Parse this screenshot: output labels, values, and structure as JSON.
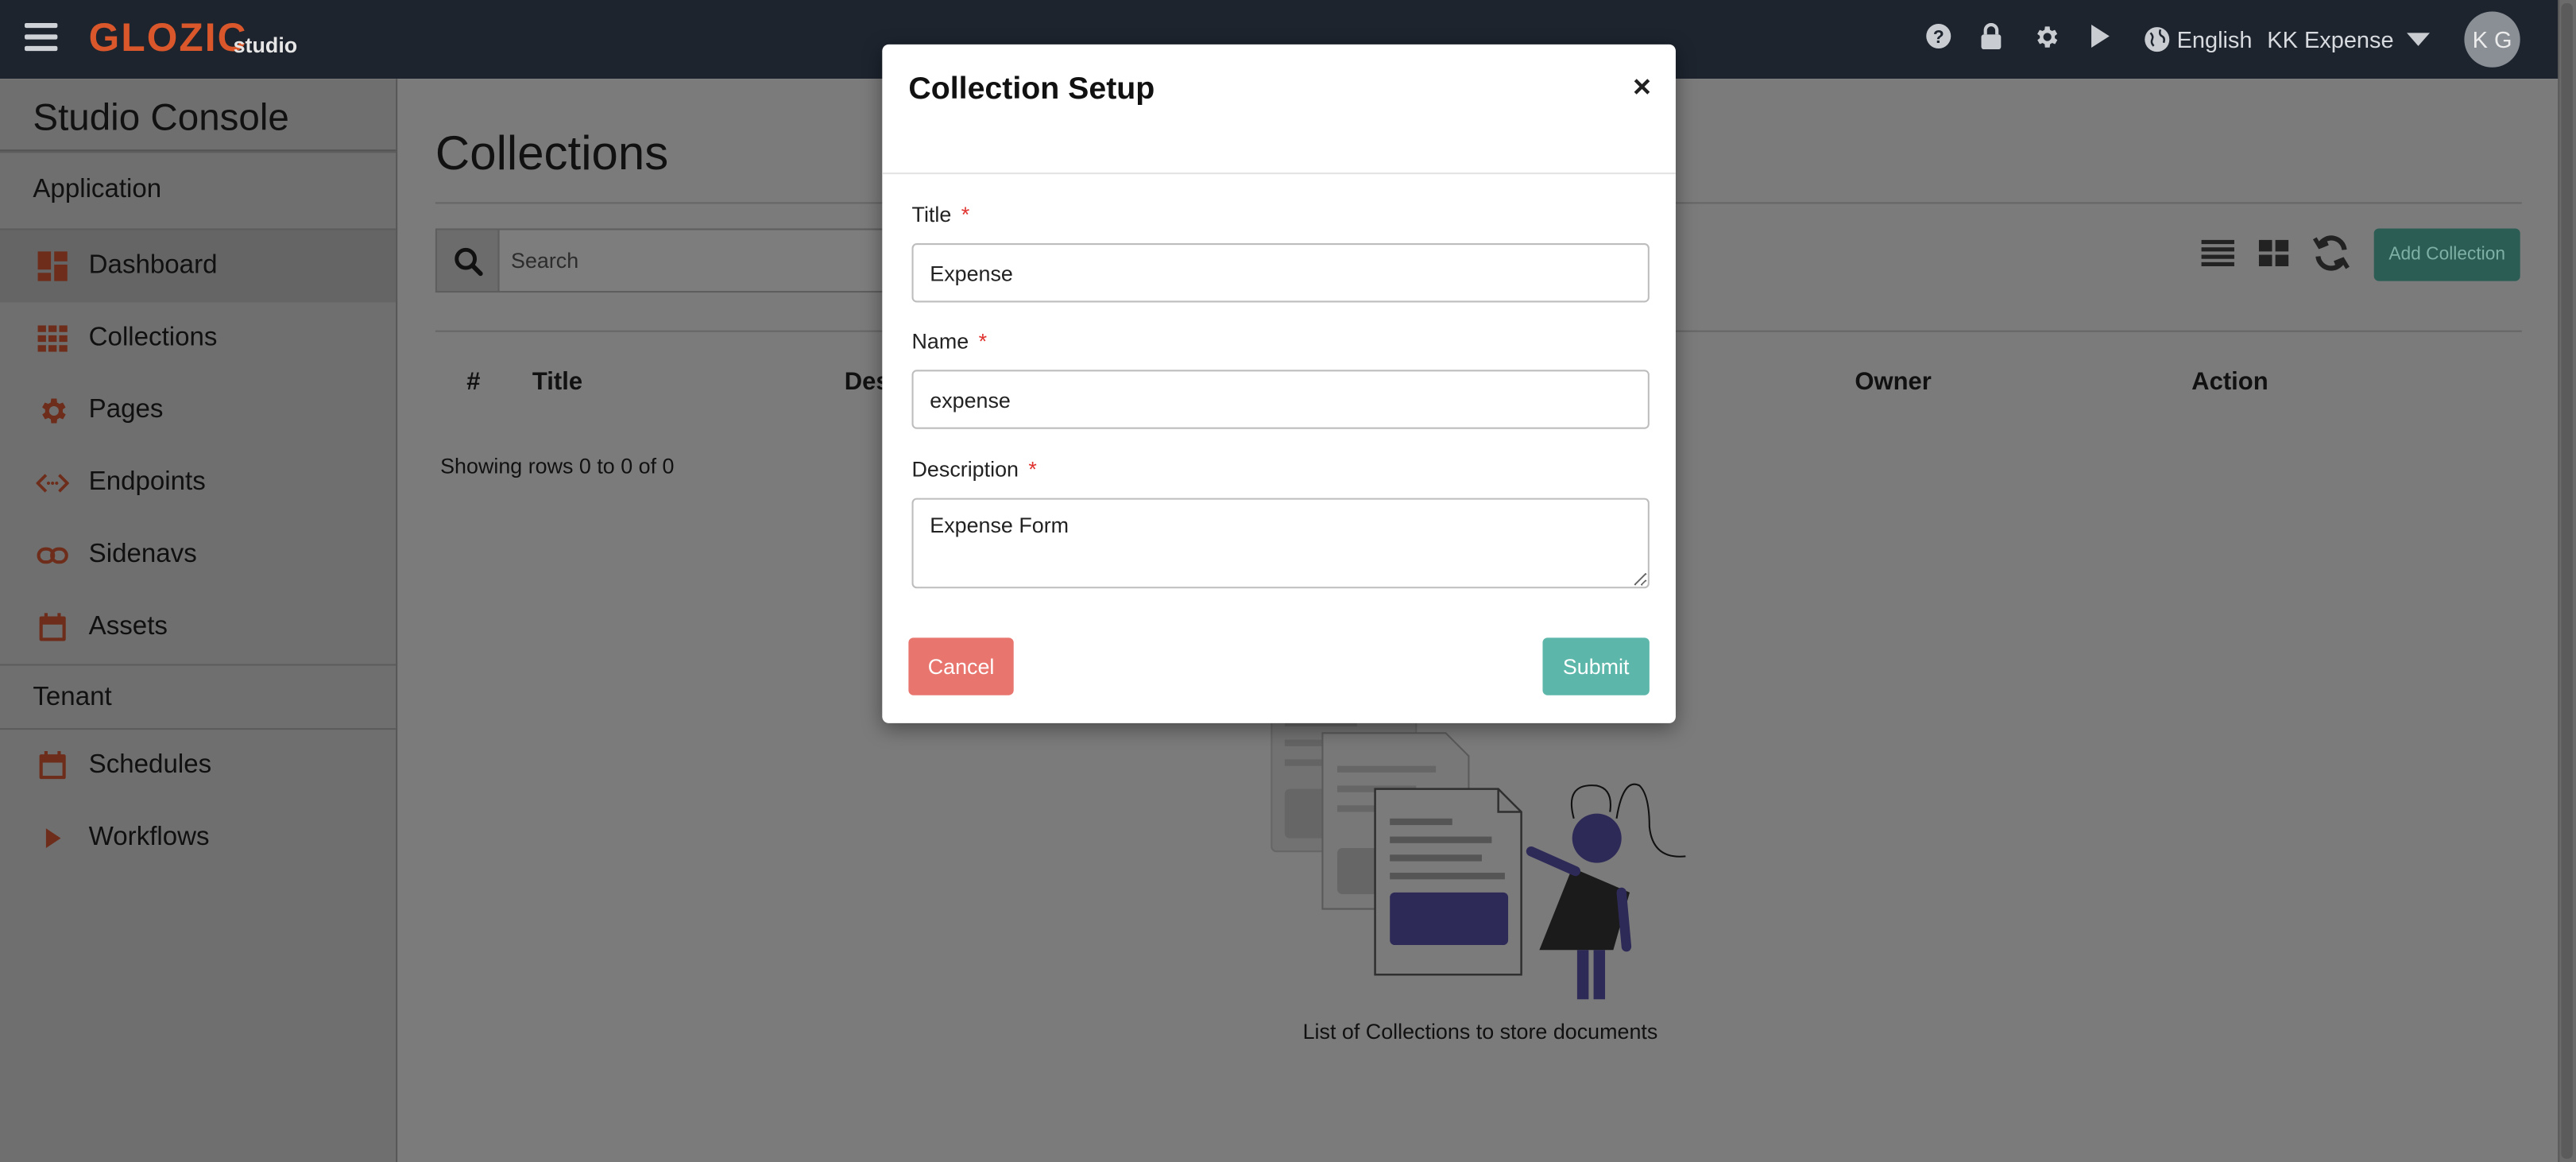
{
  "topbar": {
    "brand": "GLOZIC",
    "brand_sub": "studio",
    "language": "English",
    "user": "KK Expense",
    "avatar_initials": "K G",
    "icons": [
      "help-icon",
      "lock-icon",
      "gear-icon",
      "play-icon",
      "globe-icon"
    ]
  },
  "sidebar": {
    "title": "Studio Console",
    "sections": [
      {
        "label": "Application"
      },
      {
        "label": "Tenant"
      }
    ],
    "items": [
      {
        "label": "Dashboard",
        "icon": "dashboard-icon"
      },
      {
        "label": "Collections",
        "icon": "grid-icon"
      },
      {
        "label": "Pages",
        "icon": "gear-icon"
      },
      {
        "label": "Endpoints",
        "icon": "code-icon"
      },
      {
        "label": "Sidenavs",
        "icon": "link-icon"
      },
      {
        "label": "Assets",
        "icon": "calendar-icon"
      },
      {
        "label": "Schedules",
        "icon": "calendar-icon"
      },
      {
        "label": "Workflows",
        "icon": "play-icon"
      }
    ]
  },
  "main": {
    "title": "Collections",
    "search_placeholder": "Search",
    "add_button": "Add Collection",
    "columns": [
      "#",
      "Title",
      "Des",
      "Owner",
      "Action"
    ],
    "rows_info": "Showing rows 0 to 0 of 0",
    "empty_text": "List of Collections to store documents"
  },
  "modal": {
    "title": "Collection Setup",
    "close": "×",
    "fields": {
      "title": {
        "label": "Title",
        "value": "Expense"
      },
      "name": {
        "label": "Name",
        "value": "expense"
      },
      "description": {
        "label": "Description",
        "value": "Expense Form"
      }
    },
    "required_mark": "*",
    "cancel_label": "Cancel",
    "submit_label": "Submit"
  },
  "colors": {
    "topbar": "#1d242e",
    "brand": "#d9572a",
    "cancel": "#e8766f",
    "submit": "#5cb7aa",
    "required": "#e0332f",
    "sidebar_icon": "#6e2d1a"
  }
}
